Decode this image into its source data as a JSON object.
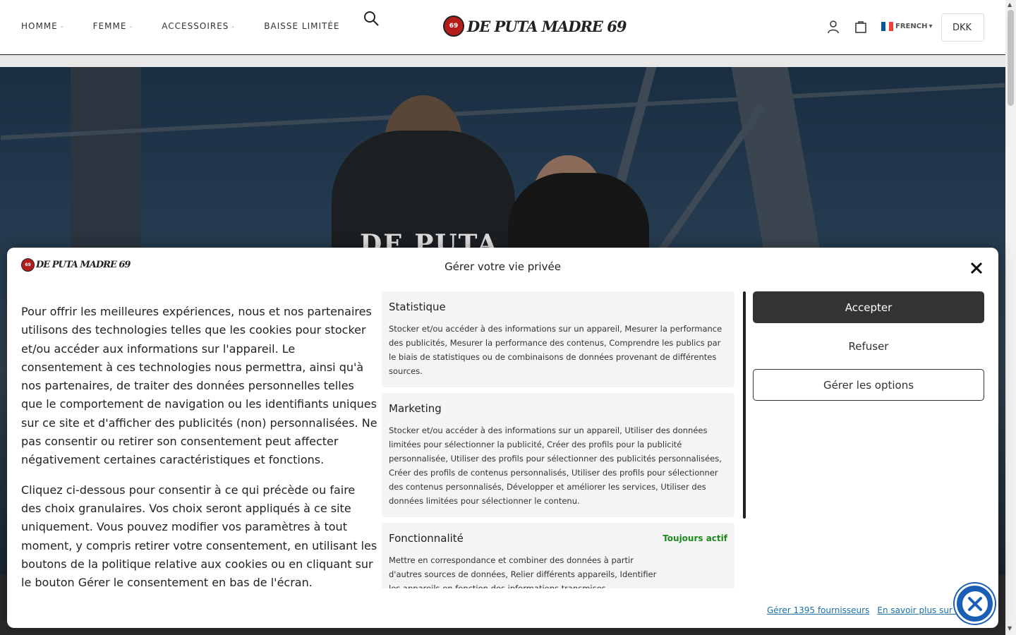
{
  "header": {
    "nav": [
      {
        "label": "HOMME",
        "has_dropdown": true
      },
      {
        "label": "FEMME",
        "has_dropdown": true
      },
      {
        "label": "ACCESSOIRES",
        "has_dropdown": true
      },
      {
        "label": "BAISSE LIMITÉE",
        "has_dropdown": false
      }
    ],
    "logo_text": "DE PUTA MADRE 69",
    "logo_badge": "69",
    "language": "FRENCH",
    "currency": "DKK"
  },
  "hero": {
    "shirt_text": "DE PUTA"
  },
  "consent": {
    "logo_text": "DE PUTA MADRE 69",
    "title": "Gérer votre vie privée",
    "paragraphs": [
      "Pour offrir les meilleures expériences, nous et nos partenaires utilisons des technologies telles que les cookies pour stocker et/ou accéder aux informations sur l'appareil. Le consentement à ces technologies nous permettra, ainsi qu'à nos partenaires, de traiter des données personnelles telles que le comportement de navigation ou les identifiants uniques sur ce site et d'afficher des publicités (non) personnalisées. Ne pas consentir ou retirer son consentement peut affecter négativement certaines caractéristiques et fonctions.",
      "Cliquez ci-dessous pour consentir à ce qui précède ou faire des choix granulaires. Vos choix seront appliqués à ce site uniquement. Vous pouvez modifier vos paramètres à tout moment, y compris retirer votre consentement, en utilisant les boutons de la politique relative aux cookies ou en cliquant sur le bouton Gérer le consentement en bas de l'écran."
    ],
    "categories": [
      {
        "title": "Statistique",
        "status": "",
        "description": "Stocker et/ou accéder à des informations sur un appareil, Mesurer la performance des publicités, Mesurer la performance des contenus, Comprendre les publics par le biais de statistiques ou de combinaisons de données provenant de différentes sources."
      },
      {
        "title": "Marketing",
        "status": "",
        "description": "Stocker et/ou accéder à des informations sur un appareil, Utiliser des données limitées pour sélectionner la publicité, Créer des profils pour la publicité personnalisée, Utiliser des profils pour sélectionner des publicités personnalisées, Créer des profils de contenus personnalisés, Utiliser des profils pour sélectionner des contenus personnalisés, Développer et améliorer les services, Utiliser des données limitées pour sélectionner le contenu."
      },
      {
        "title": "Fonctionnalité",
        "status": "Toujours actif",
        "description": "Mettre en correspondance et combiner des données à partir d'autres sources de données, Relier différents appareils, Identifier les appareils en fonction des informations transmises automatiquement."
      }
    ],
    "buttons": {
      "accept": "Accepter",
      "refuse": "Refuser",
      "manage": "Gérer les options"
    },
    "links": {
      "vendors": "Gérer 1395 fournisseurs",
      "learn_more": "En savoir plus sur ces fins"
    }
  },
  "colors": {
    "accent_dark": "#333333",
    "status_green": "#1e8a1e",
    "link_blue": "#1a6fa8",
    "a11y_blue": "#1a5fb4"
  }
}
